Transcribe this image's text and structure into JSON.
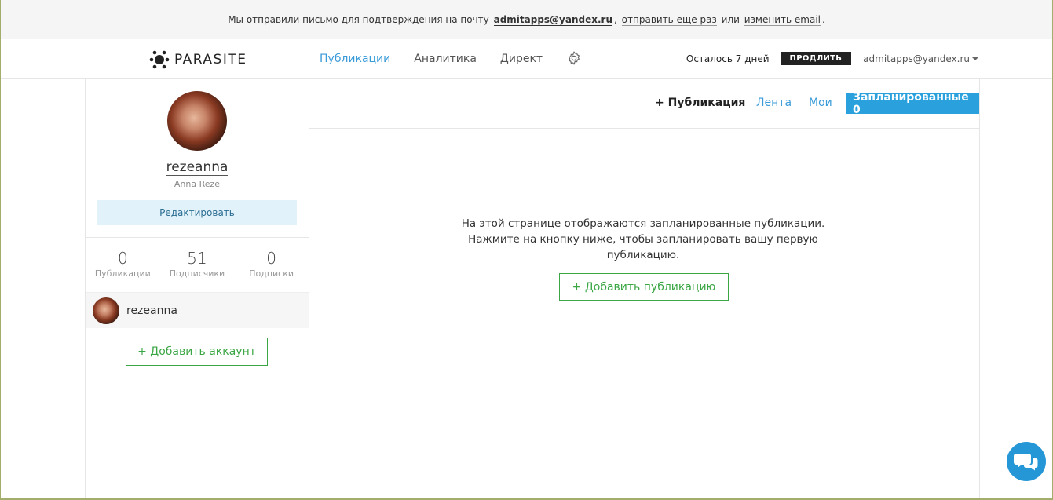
{
  "notice": {
    "text_before": "Мы отправили письмо для подтверждения на почту",
    "email": "admitapps@yandex.ru",
    "comma": ",",
    "resend": "отправить еще раз",
    "or": "или",
    "change": "изменить email",
    "end": "."
  },
  "header": {
    "logo_text": "PARASITE",
    "nav": [
      "Публикации",
      "Аналитика",
      "Директ"
    ],
    "days_left": "Осталось 7 дней",
    "prolong": "ПРОДЛИТЬ",
    "user_email": "admitapps@yandex.ru"
  },
  "profile": {
    "username": "rezeanna",
    "real_name": "Anna Reze",
    "edit_label": "Редактировать",
    "stats": [
      {
        "value": "0",
        "label": "Публикации"
      },
      {
        "value": "51",
        "label": "Подписчики"
      },
      {
        "value": "0",
        "label": "Подписки"
      }
    ],
    "account_name": "rezeanna",
    "add_account": "+ Добавить аккаунт"
  },
  "toolbar": {
    "add_publication": "+ Публикация",
    "feed": "Лента",
    "mine": "Мои",
    "scheduled": "Запланированные 0"
  },
  "main": {
    "empty_line1": "На этой странице отображаются запланированные публикации.",
    "empty_line2": "Нажмите на кнопку ниже, чтобы запланировать вашу первую публикацию.",
    "add_button": "+ Добавить публикацию"
  },
  "colors": {
    "accent_blue": "#2aa1dc",
    "green": "#3aa644",
    "link_blue": "#3a9bd9"
  }
}
